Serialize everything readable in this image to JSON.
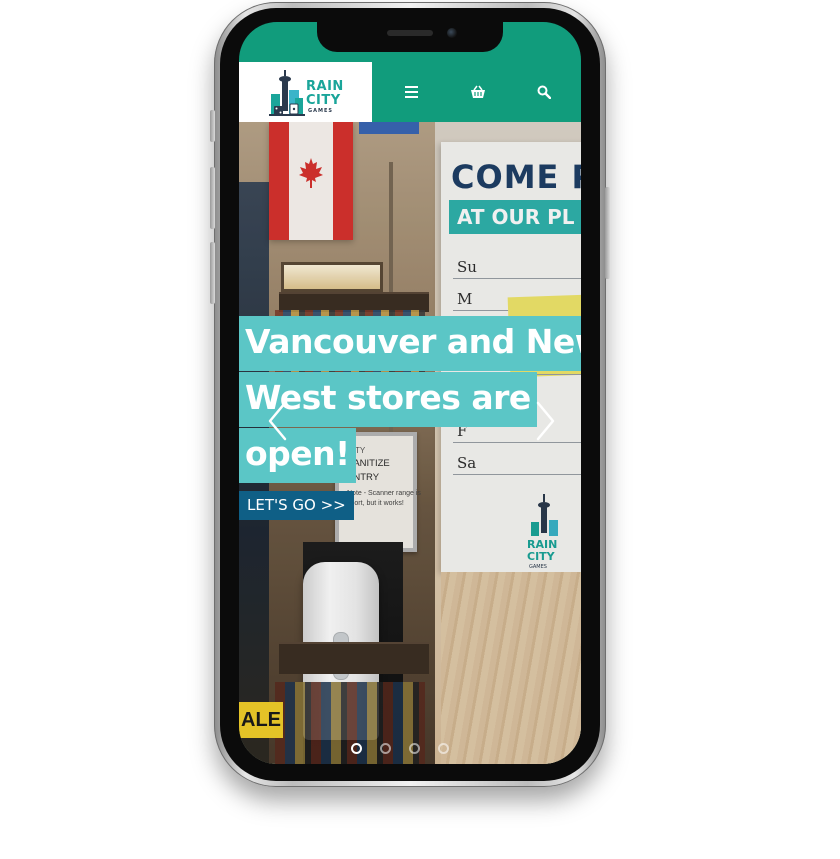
{
  "header": {
    "logo": {
      "line1": "RAIN",
      "line2": "CITY",
      "line3": "GAMES"
    },
    "nav_icons": [
      "menu-icon",
      "cart-icon",
      "search-icon"
    ],
    "colors": {
      "header_bg": "#119c7c",
      "logo_teal": "#1aa59a",
      "logo_navy": "#2b3a4d"
    }
  },
  "hero": {
    "headline_lines": [
      "Vancouver and New",
      "West stores are",
      "open!"
    ],
    "cta_label": "LET'S GO >>",
    "slides_total": 4,
    "active_slide": 1,
    "colors": {
      "headline_bg": "#5bc6c6",
      "cta_bg": "#0f5f86"
    }
  },
  "photo_text": {
    "poster_title": "COME PL",
    "poster_banner": "AT OUR PL",
    "poster_days": [
      "Su",
      "M",
      "F",
      "Sa"
    ],
    "sign_lines": [
      "CITY",
      "SANITIZE",
      "ENTRY",
      "Note - Scanner range is",
      "short, but it works!"
    ],
    "sale_tag": "ALE"
  }
}
